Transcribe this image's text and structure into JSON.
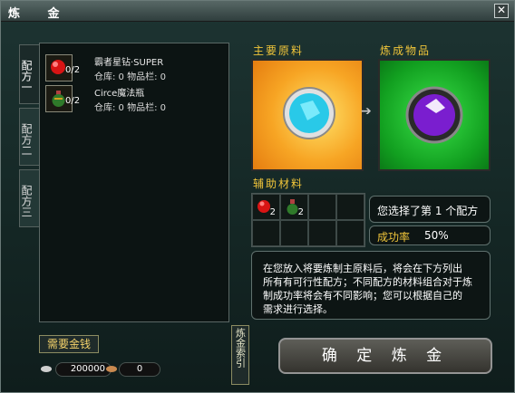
{
  "window": {
    "title": "炼 金"
  },
  "tabs": [
    "配方一",
    "配方二",
    "配方三"
  ],
  "recipes": [
    {
      "name": "霸者星钻·SUPER",
      "stock": "仓库: 0  物品栏: 0",
      "count": "0/2",
      "icon": "red-gem-icon"
    },
    {
      "name": "Circe魔法瓶",
      "stock": "仓库: 0  物品栏: 0",
      "count": "0/2",
      "icon": "bottle-icon"
    }
  ],
  "labels": {
    "main_material": "主要原料",
    "result_item": "炼成物品",
    "aux_material": "辅助材料"
  },
  "aux_slots": [
    {
      "icon": "red-gem-icon",
      "count": "2"
    },
    {
      "icon": "bottle-icon",
      "count": "2"
    }
  ],
  "selection": {
    "text": "您选择了第 1 个配方",
    "rate_label": "成功率",
    "rate_value": "50%"
  },
  "description": [
    "在您放入将要炼制主原料后，将会在下方列出",
    "所有有可行性配方；不同配方的材料组合对于炼",
    "制成功率将会有不同影响；您可以根据自己的",
    "需求进行选择。"
  ],
  "footer": {
    "gold_label": "需要金钱",
    "money_amount": "200000",
    "money_second": "0",
    "index_label": "炼金索引",
    "confirm_label": "确 定 炼 金"
  },
  "colors": {
    "accent": "#f0c53a",
    "panel": "#0c1413"
  }
}
